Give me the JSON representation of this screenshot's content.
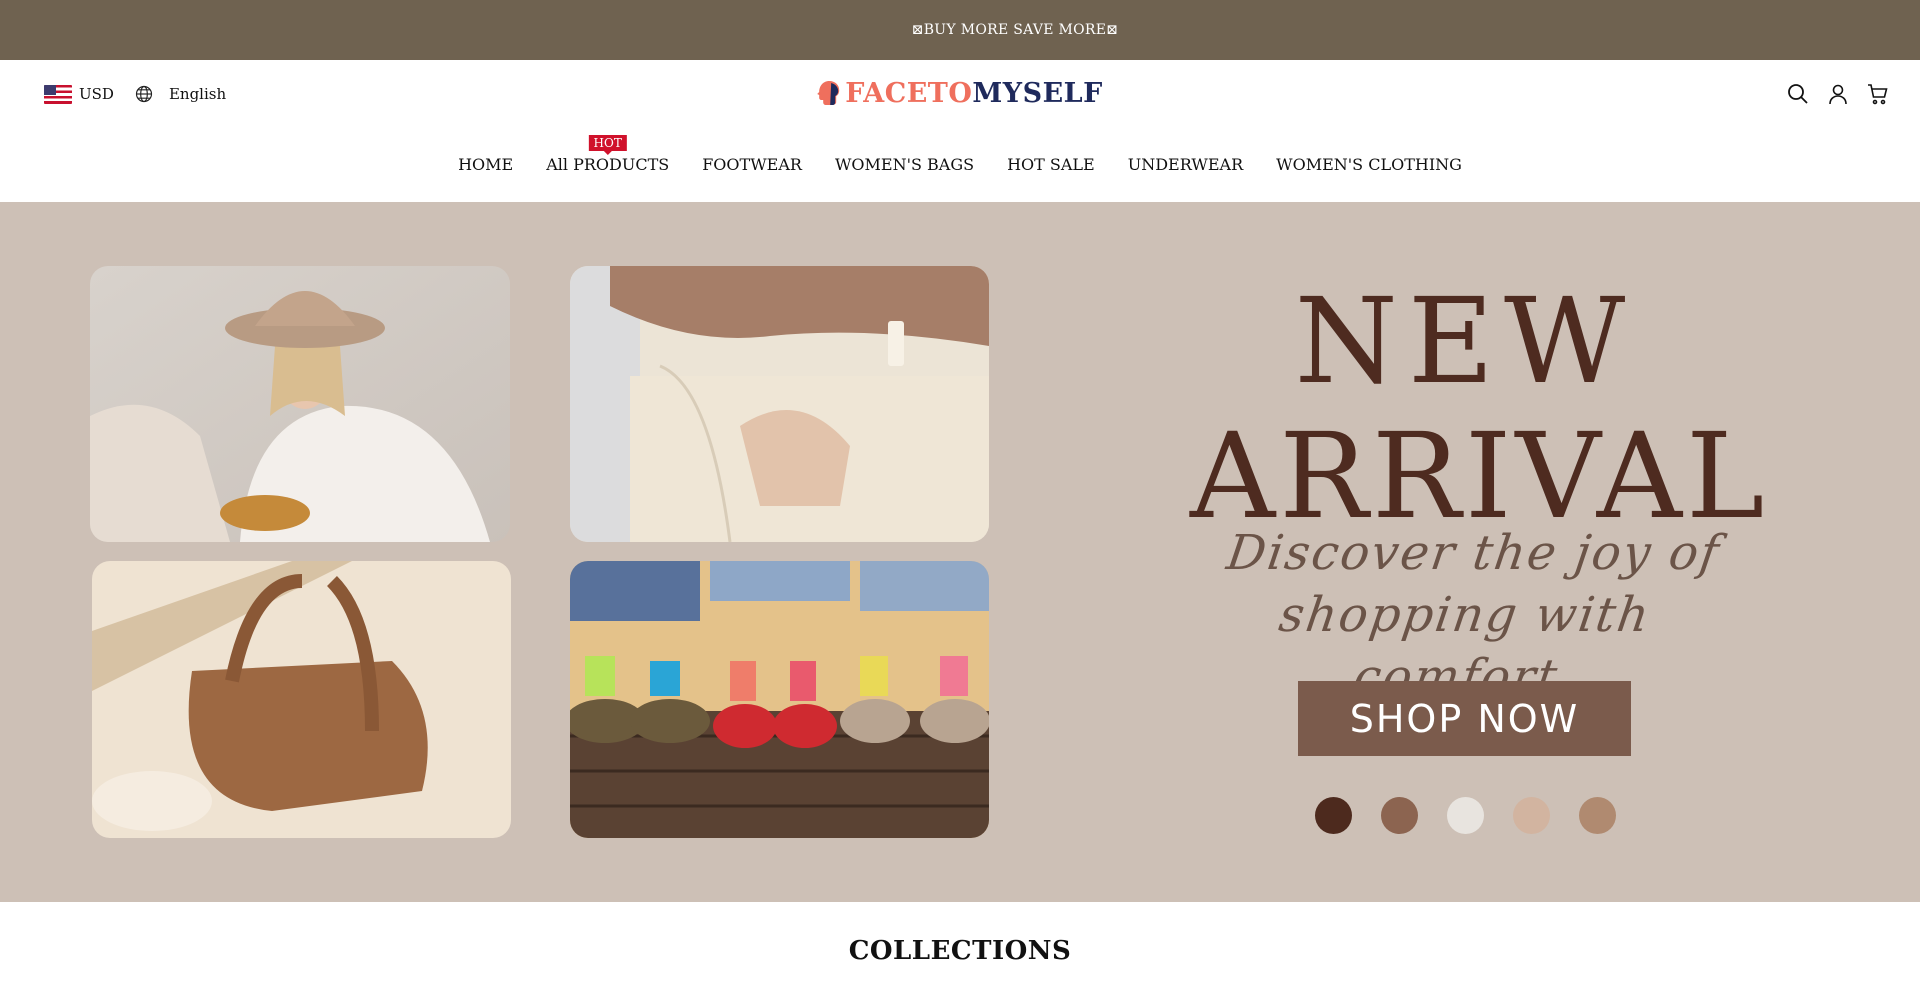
{
  "announcement": {
    "text": "⊠BUY MORE SAVE MORE⊠"
  },
  "header": {
    "currency": "USD",
    "language": "English",
    "logo_part1": "FACETO",
    "logo_part2": "MYSELF"
  },
  "nav": {
    "items": [
      {
        "label": "HOME"
      },
      {
        "label": "All PRODUCTS",
        "badge": "HOT"
      },
      {
        "label": "FOOTWEAR"
      },
      {
        "label": "WOMEN'S BAGS"
      },
      {
        "label": "HOT SALE"
      },
      {
        "label": "UNDERWEAR"
      },
      {
        "label": "WOMEN'S CLOTHING"
      }
    ]
  },
  "hero": {
    "headline_line1": "NEW",
    "headline_line2": "ARRIVAL",
    "tagline_line1": "Discover the joy of",
    "tagline_line2": "shopping with comfort",
    "button": "SHOP NOW",
    "swatch_colors": [
      "#4d2a1e",
      "#8c6450",
      "#e8e4df",
      "#d2b4a0",
      "#b08a70"
    ]
  },
  "collections": {
    "title": "COLLECTIONS"
  },
  "colors": {
    "announcement_bg": "#6f6250",
    "hero_bg": "#cdc0b6",
    "headline": "#4e2b20",
    "button_bg": "#7b5b4c",
    "hot_badge": "#d0112b"
  }
}
